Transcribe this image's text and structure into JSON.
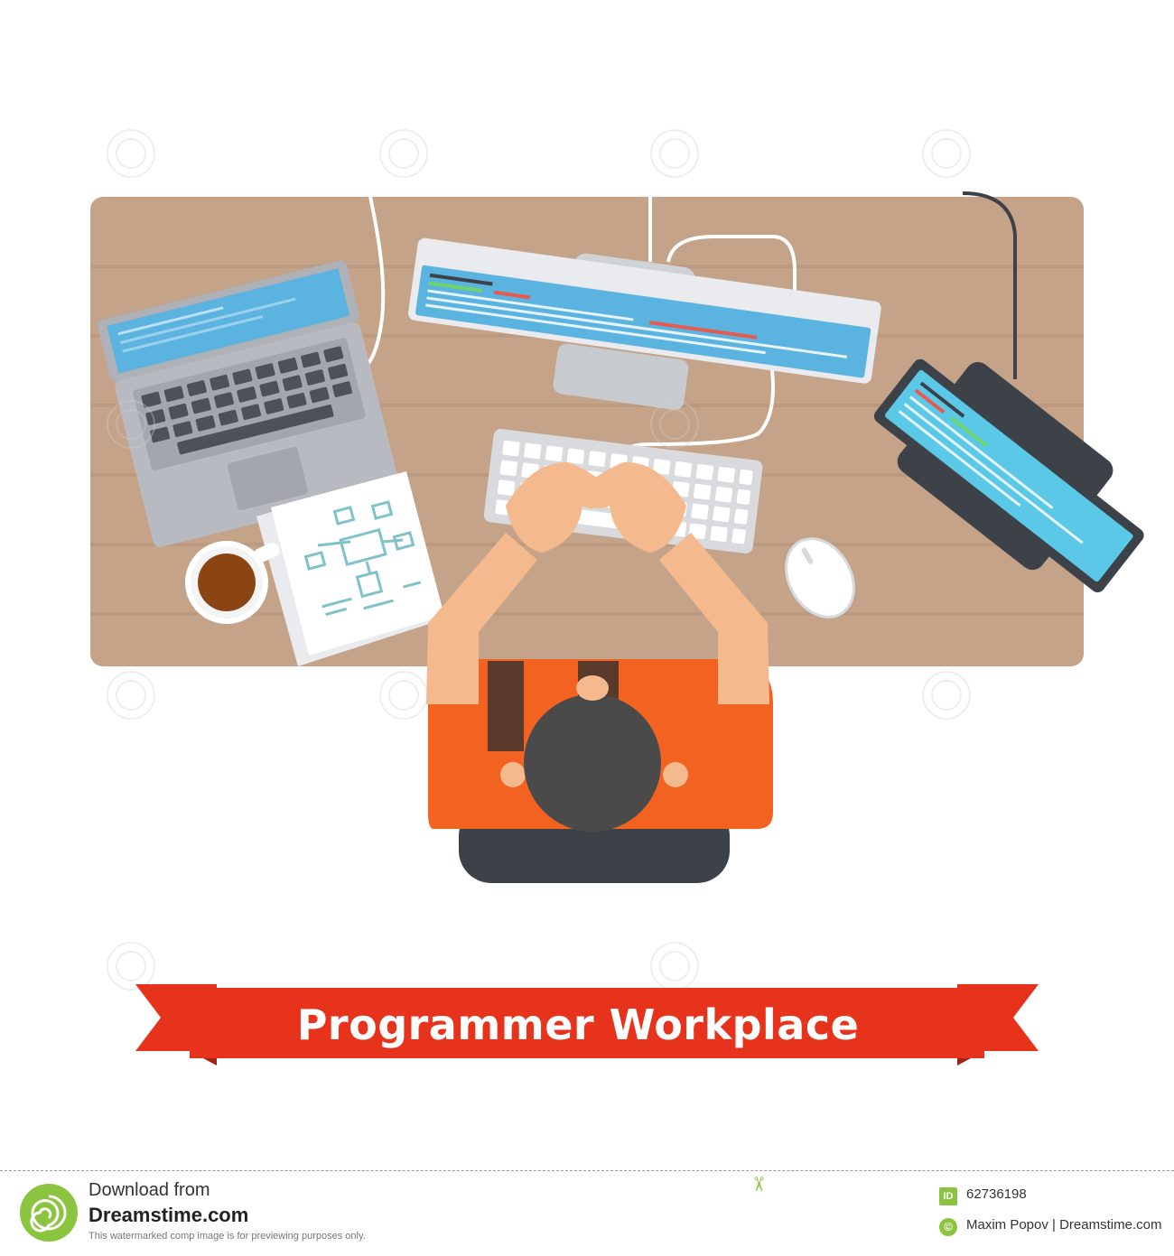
{
  "banner": {
    "title": "Programmer Workplace"
  },
  "watermark": {
    "text": "dreamstime"
  },
  "footer": {
    "download_from": "Download from",
    "site": "Dreamstime.com",
    "note": "This watermarked comp image is for previewing purposes only.",
    "id_label": "ID",
    "id_value": "62736198",
    "copyright_symbol": "©",
    "credit": "Maxim Popov | Dreamstime.com"
  },
  "colors": {
    "desk": "#c4a389",
    "shirt": "#f26322",
    "banner_red": "#e8331c",
    "screen_blue": "#5bb3e0",
    "brand_green": "#8bc53f"
  }
}
